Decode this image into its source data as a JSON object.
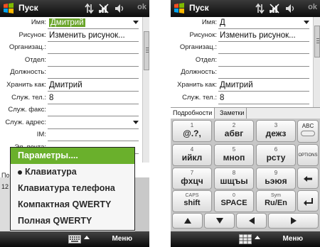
{
  "left": {
    "title": "Пуск",
    "ok": "ok",
    "fields": [
      {
        "label": "Имя:",
        "value": "Дмитрий",
        "selected": true,
        "dropdown": true
      },
      {
        "label": "Рисунок:",
        "value": "Изменить рисунок...",
        "dropdown": false
      },
      {
        "label": "Организац.:",
        "value": ""
      },
      {
        "label": "Отдел:",
        "value": ""
      },
      {
        "label": "Должность:",
        "value": ""
      },
      {
        "label": "Хранить как:",
        "value": "Дмитрий"
      },
      {
        "label": "Служ. тел.:",
        "value": "8"
      },
      {
        "label": "Служ. факс:",
        "value": ""
      },
      {
        "label": "Служ. адрес:",
        "value": "",
        "dropdown": true
      },
      {
        "label": "IM:",
        "value": ""
      },
      {
        "label": "Эл. почта:",
        "value": ""
      }
    ],
    "partial_label": "По",
    "partial_value": "12",
    "popup": [
      {
        "label": "Параметры....",
        "active": true,
        "bullet": false
      },
      {
        "label": "Клавиатура",
        "active": false,
        "bullet": true
      },
      {
        "label": "Клавиатура телефона",
        "active": false,
        "bullet": false
      },
      {
        "label": "Компактная QWERTY",
        "active": false,
        "bullet": false
      },
      {
        "label": "Полная QWERTY",
        "active": false,
        "bullet": false
      }
    ],
    "menu": "Меню"
  },
  "right": {
    "title": "Пуск",
    "ok": "ok",
    "fields": [
      {
        "label": "Имя:",
        "value": "Д",
        "dropdown": true
      },
      {
        "label": "Рисунок:",
        "value": "Изменить рисунок..."
      },
      {
        "label": "Организац.:",
        "value": ""
      },
      {
        "label": "Отдел:",
        "value": ""
      },
      {
        "label": "Должность:",
        "value": ""
      },
      {
        "label": "Хранить как:",
        "value": "Дмитрий"
      },
      {
        "label": "Служ. тел.:",
        "value": "8"
      }
    ],
    "tabs": [
      "Подробности",
      "Заметки"
    ],
    "keys": [
      {
        "digit": "1",
        "chars": "@.?,"
      },
      {
        "digit": "2",
        "chars": "абвг"
      },
      {
        "digit": "3",
        "chars": "дежз"
      },
      {
        "digit": "4",
        "chars": "ийкл"
      },
      {
        "digit": "5",
        "chars": "мноп"
      },
      {
        "digit": "6",
        "chars": "рсту"
      },
      {
        "digit": "7",
        "chars": "фхцч"
      },
      {
        "digit": "8",
        "chars": "шщъы"
      },
      {
        "digit": "9",
        "chars": "ьэюя"
      },
      {
        "digit": "CAPS",
        "chars": "shift"
      },
      {
        "digit": "0",
        "chars": "SPACE"
      },
      {
        "digit": "Sym",
        "chars": "Ru/En"
      }
    ],
    "side_keys": {
      "abc": "ABC",
      "options": "OPTIONS"
    },
    "menu": "Меню"
  }
}
